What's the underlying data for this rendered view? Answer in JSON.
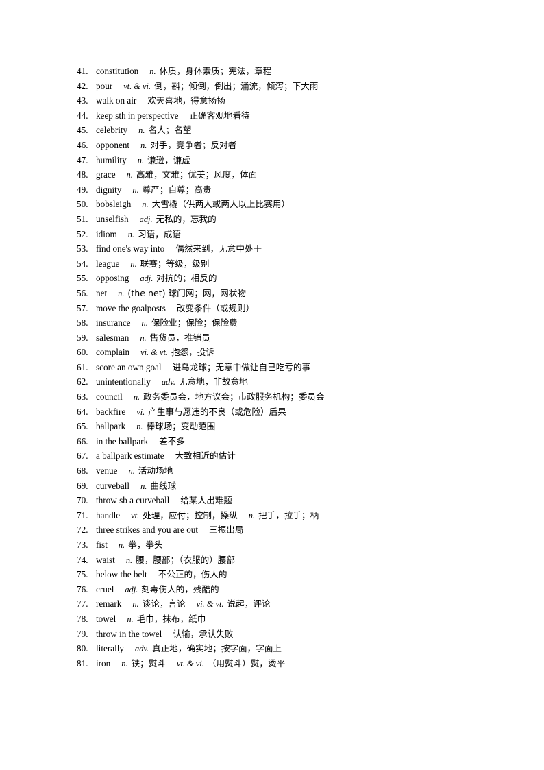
{
  "page": {
    "type": "vocabulary-list",
    "background_color": "#ffffff",
    "text_color": "#000000",
    "first_number": 41,
    "last_number": 81
  },
  "entries": [
    {
      "num": "41.",
      "word": "constitution",
      "parts": [
        {
          "pos": "n.",
          "def": "体质，身体素质；宪法，章程"
        }
      ]
    },
    {
      "num": "42.",
      "word": "pour",
      "parts": [
        {
          "pos": "vt. & vi.",
          "def": "倒，斟；倾倒，倒出；涌流，倾泻；下大雨"
        }
      ]
    },
    {
      "num": "43.",
      "word": "walk on air",
      "parts": [
        {
          "pos": "",
          "def": "欢天喜地，得意扬扬"
        }
      ]
    },
    {
      "num": "44.",
      "word": "keep sth in perspective",
      "parts": [
        {
          "pos": "",
          "def": "正确客观地看待"
        }
      ]
    },
    {
      "num": "45.",
      "word": "celebrity",
      "parts": [
        {
          "pos": "n.",
          "def": "名人；名望"
        }
      ]
    },
    {
      "num": "46.",
      "word": "opponent",
      "parts": [
        {
          "pos": "n.",
          "def": "对手，竞争者；反对者"
        }
      ]
    },
    {
      "num": "47.",
      "word": "humility",
      "parts": [
        {
          "pos": "n.",
          "def": "谦逊，谦虚"
        }
      ]
    },
    {
      "num": "48.",
      "word": "grace",
      "parts": [
        {
          "pos": "n.",
          "def": "高雅，文雅；优美；风度，体面"
        }
      ]
    },
    {
      "num": "49.",
      "word": "dignity",
      "parts": [
        {
          "pos": "n.",
          "def": "尊严；自尊；高贵"
        }
      ]
    },
    {
      "num": "50.",
      "word": "bobsleigh",
      "parts": [
        {
          "pos": "n.",
          "def": "大雪橇（供两人或两人以上比赛用）"
        }
      ]
    },
    {
      "num": "51.",
      "word": "unselfish",
      "parts": [
        {
          "pos": "adj.",
          "def": "无私的，忘我的"
        }
      ]
    },
    {
      "num": "52.",
      "word": "idiom",
      "parts": [
        {
          "pos": "n.",
          "def": "习语，成语"
        }
      ]
    },
    {
      "num": "53.",
      "word": "find one's way into",
      "parts": [
        {
          "pos": "",
          "def": "偶然来到，无意中处于"
        }
      ]
    },
    {
      "num": "54.",
      "word": "league",
      "parts": [
        {
          "pos": "n.",
          "def": "联赛；等级，级别"
        }
      ]
    },
    {
      "num": "55.",
      "word": "opposing",
      "parts": [
        {
          "pos": "adj.",
          "def": "对抗的；相反的"
        }
      ]
    },
    {
      "num": "56.",
      "word": "net",
      "parts": [
        {
          "pos": "n.",
          "def": "(the net) 球门网；网，网状物"
        }
      ]
    },
    {
      "num": "57.",
      "word": "move the goalposts",
      "parts": [
        {
          "pos": "",
          "def": "改变条件（或规则）"
        }
      ]
    },
    {
      "num": "58.",
      "word": "insurance",
      "parts": [
        {
          "pos": "n.",
          "def": "保险业；保险；保险费"
        }
      ]
    },
    {
      "num": "59.",
      "word": "salesman",
      "parts": [
        {
          "pos": "n.",
          "def": "售货员，推销员"
        }
      ]
    },
    {
      "num": "60.",
      "word": "complain",
      "parts": [
        {
          "pos": "vi. & vt.",
          "def": "抱怨，投诉"
        }
      ]
    },
    {
      "num": "61.",
      "word": "score an own goal",
      "parts": [
        {
          "pos": "",
          "def": "进乌龙球；无意中做让自己吃亏的事"
        }
      ]
    },
    {
      "num": "62.",
      "word": "unintentionally",
      "parts": [
        {
          "pos": "adv.",
          "def": "无意地，非故意地"
        }
      ]
    },
    {
      "num": "63.",
      "word": "council",
      "parts": [
        {
          "pos": "n.",
          "def": "政务委员会，地方议会；市政服务机构；委员会"
        }
      ]
    },
    {
      "num": "64.",
      "word": "backfire",
      "parts": [
        {
          "pos": "vi.",
          "def": "产生事与愿违的不良（或危险）后果"
        }
      ]
    },
    {
      "num": "65.",
      "word": "ballpark",
      "parts": [
        {
          "pos": "n.",
          "def": "棒球场；变动范围"
        }
      ]
    },
    {
      "num": "66.",
      "word": "in the ballpark",
      "parts": [
        {
          "pos": "",
          "def": "差不多"
        }
      ]
    },
    {
      "num": "67.",
      "word": "a ballpark estimate",
      "parts": [
        {
          "pos": "",
          "def": "大致相近的估计"
        }
      ]
    },
    {
      "num": "68.",
      "word": "venue",
      "parts": [
        {
          "pos": "n.",
          "def": "活动场地"
        }
      ]
    },
    {
      "num": "69.",
      "word": "curveball",
      "parts": [
        {
          "pos": "n.",
          "def": "曲线球"
        }
      ]
    },
    {
      "num": "70.",
      "word": "throw sb a curveball",
      "parts": [
        {
          "pos": "",
          "def": "给某人出难题"
        }
      ]
    },
    {
      "num": "71.",
      "word": "handle",
      "parts": [
        {
          "pos": "vt.",
          "def": "处理，应付；控制，操纵"
        },
        {
          "pos": "n.",
          "def": "把手，拉手；柄"
        }
      ]
    },
    {
      "num": "72.",
      "word": "three strikes and you are out",
      "parts": [
        {
          "pos": "",
          "def": "三振出局"
        }
      ]
    },
    {
      "num": "73.",
      "word": "fist",
      "parts": [
        {
          "pos": "n.",
          "def": "拳，拳头"
        }
      ]
    },
    {
      "num": "74.",
      "word": "waist",
      "parts": [
        {
          "pos": "n.",
          "def": "腰，腰部；（衣服的）腰部"
        }
      ]
    },
    {
      "num": "75.",
      "word": "below the belt",
      "parts": [
        {
          "pos": "",
          "def": "不公正的，伤人的"
        }
      ]
    },
    {
      "num": "76.",
      "word": "cruel",
      "parts": [
        {
          "pos": "adj.",
          "def": "刻毒伤人的，残酷的"
        }
      ]
    },
    {
      "num": "77.",
      "word": "remark",
      "parts": [
        {
          "pos": "n.",
          "def": "谈论，言论"
        },
        {
          "pos": "vi. & vt.",
          "def": "说起，评论"
        }
      ]
    },
    {
      "num": "78.",
      "word": "towel",
      "parts": [
        {
          "pos": "n.",
          "def": "毛巾，抹布，纸巾"
        }
      ]
    },
    {
      "num": "79.",
      "word": "throw in the towel",
      "parts": [
        {
          "pos": "",
          "def": "认输，承认失败"
        }
      ]
    },
    {
      "num": "80.",
      "word": "literally",
      "parts": [
        {
          "pos": "adv.",
          "def": "真正地，确实地；按字面，字面上"
        }
      ]
    },
    {
      "num": "81.",
      "word": "iron",
      "parts": [
        {
          "pos": "n.",
          "def": "铁；熨斗"
        },
        {
          "pos": "vt. & vi.",
          "def": "（用熨斗）熨，烫平"
        }
      ]
    }
  ]
}
